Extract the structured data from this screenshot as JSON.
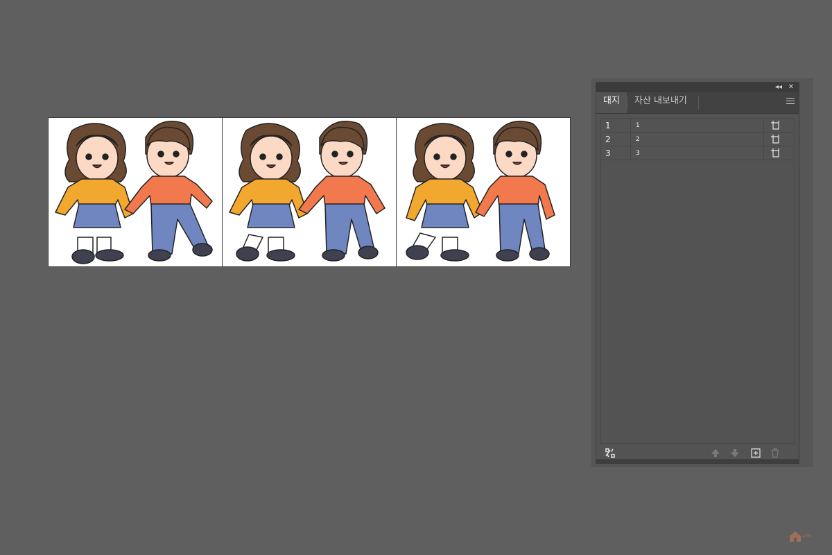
{
  "panel": {
    "collapse_label": "◂◂",
    "close_label": "✕",
    "tabs": [
      {
        "label": "대지",
        "active": true
      },
      {
        "label": "자산 내보내기",
        "active": false
      }
    ],
    "artboards": [
      {
        "number": "1",
        "name": "1"
      },
      {
        "number": "2",
        "name": "2"
      },
      {
        "number": "3",
        "name": "3"
      }
    ],
    "bottom_icons": [
      "rearrange-icon",
      "move-up-icon",
      "move-down-icon",
      "new-artboard-icon",
      "delete-icon"
    ]
  },
  "artboards_canvas": [
    {
      "name": "artboard-1",
      "girl_pose": "left-foot-forward",
      "boy_pose": "right-leg-kick"
    },
    {
      "name": "artboard-2",
      "girl_pose": "left-leg-kick",
      "boy_pose": "right-leg-kick"
    },
    {
      "name": "artboard-3",
      "girl_pose": "left-leg-kick-high",
      "boy_pose": "right-leg-stride"
    }
  ],
  "watermark": {
    "text": "LOAN"
  },
  "colors": {
    "workspace": "#5f5f5f",
    "panel": "#535353",
    "hair": "#6b4a33",
    "girl_top": "#f2a82e",
    "boy_top": "#f2784e",
    "bottoms": "#6f86c0",
    "shoes": "#3f4150",
    "skin": "#fcd9c4"
  }
}
